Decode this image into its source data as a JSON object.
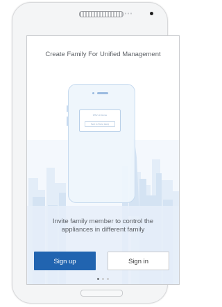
{
  "screen": {
    "headline": "Create Family For Unified Management",
    "illustration": {
      "dialog_line_1": "Who's in Home",
      "dialog_line_2": "Sent to Xiong Heng"
    },
    "description_line_1": "Invite family member to control the",
    "description_line_2": "appliances in different family",
    "sign_up_label": "Sign up",
    "sign_in_label": "Sign in",
    "pager": {
      "count": 3,
      "active_index": 0
    }
  },
  "colors": {
    "primary_button": "#2164b0",
    "skyline_light": "#dde9f6",
    "skyline_dark": "#c3d8ee"
  }
}
